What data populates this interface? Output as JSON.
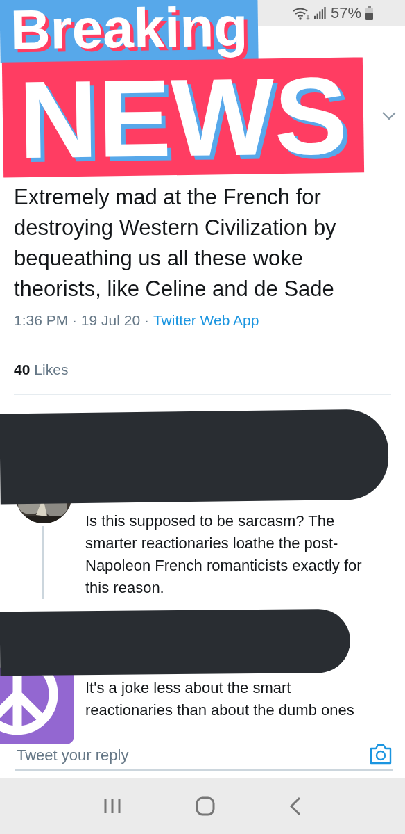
{
  "status_bar": {
    "battery": "57%"
  },
  "sticker": {
    "line_1": "Breaking",
    "line_2": "NEWS"
  },
  "tweet": {
    "text": "Extremely mad at the French for destroying Western Civilization by bequeathing us all these woke theorists, like Celine and de Sade",
    "time": "1:36 PM · 19 Jul 20 ·",
    "source": "Twitter Web App",
    "likes_count": "40",
    "likes_label": "Likes"
  },
  "replies": [
    {
      "thread_line": true,
      "text": "Is this supposed to be sarcasm? The smarter reactionaries loathe the post-Napoleon French romanticists exactly for this reason."
    },
    {
      "avatar": {
        "kind": "peace"
      },
      "thread_line": false,
      "text": "It's a joke less about the smart reactionaries than about the dumb ones"
    }
  ],
  "reply_field": {
    "placeholder": "Tweet your reply"
  }
}
